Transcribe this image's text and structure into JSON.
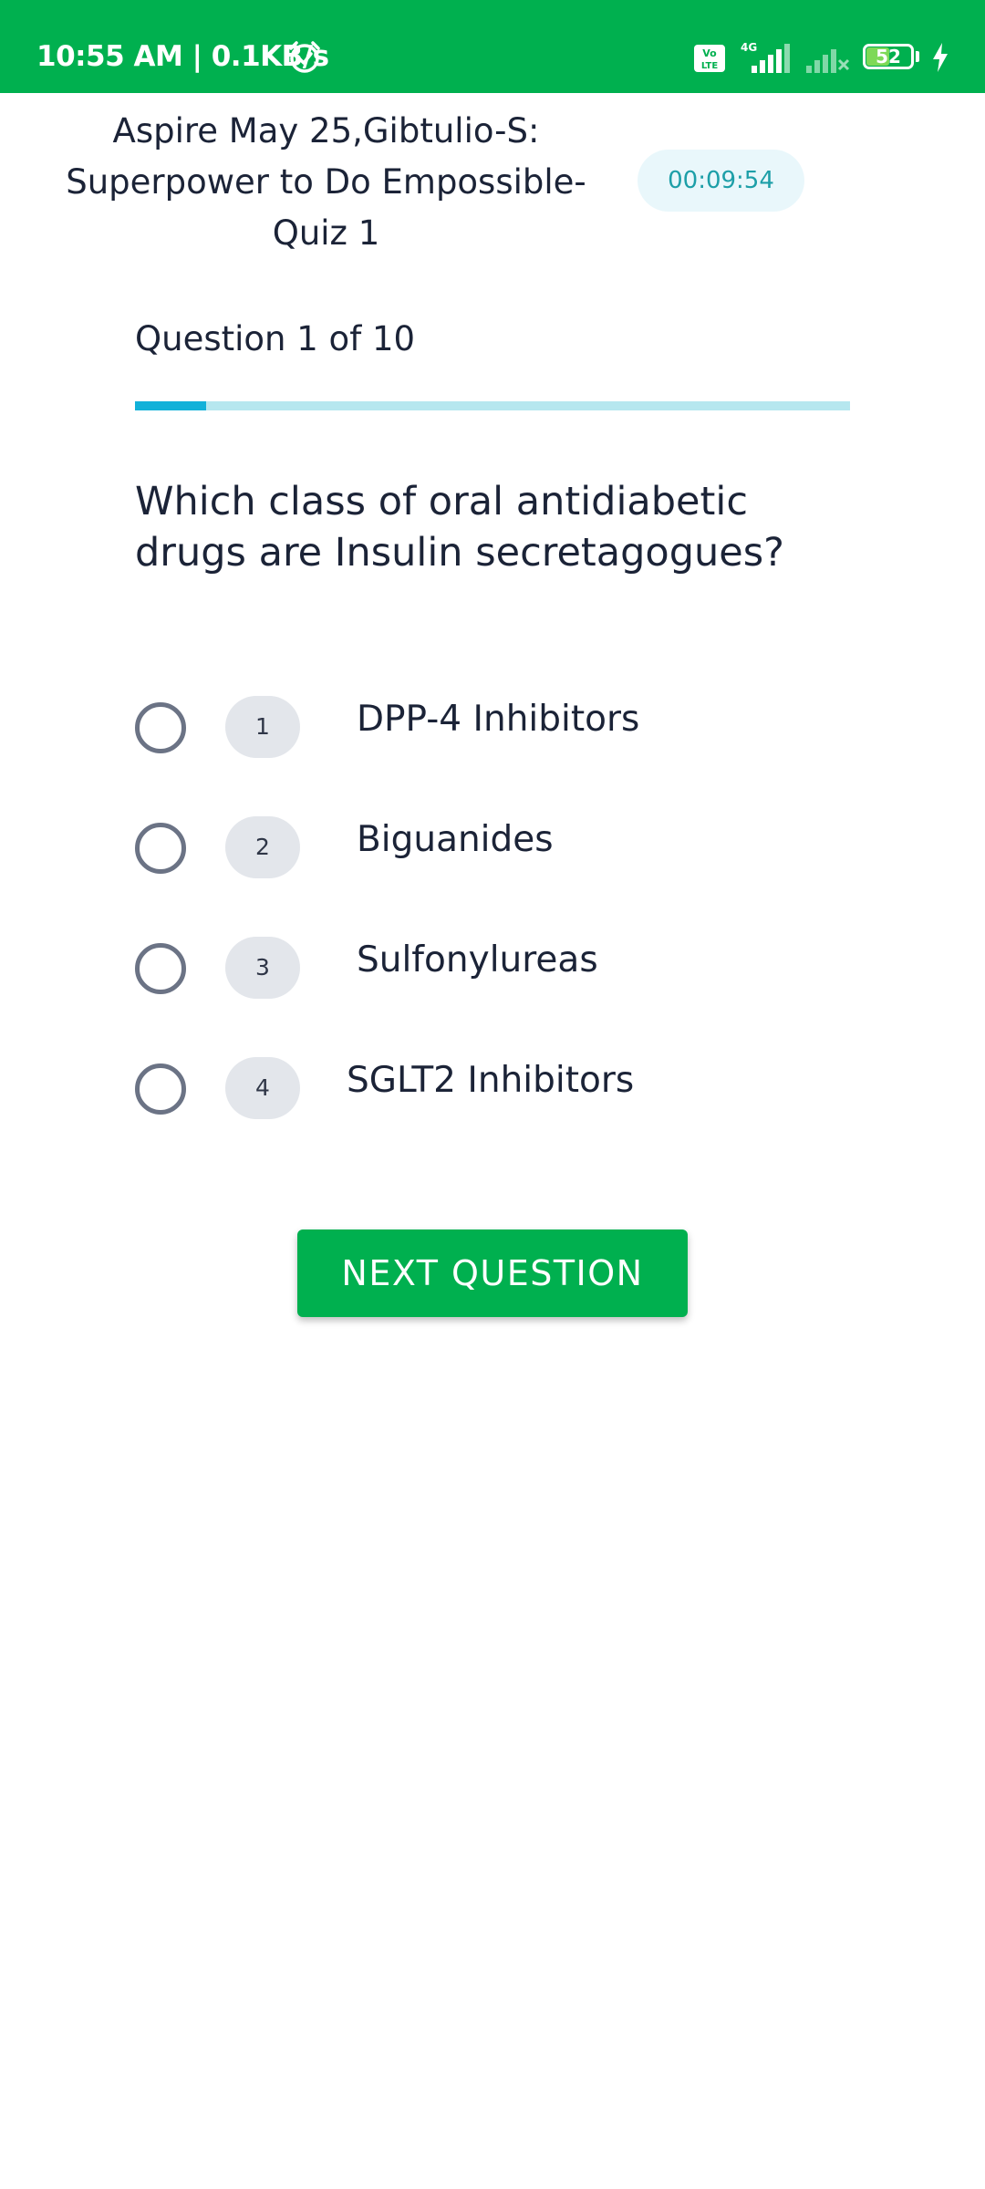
{
  "status_bar": {
    "time": "10:55 AM | 0.1KB/s",
    "battery": "52",
    "battery_level": 0.52,
    "icons": [
      "alarm-icon",
      "volte-icon",
      "signal-icon",
      "signal-icon",
      "battery-icon",
      "charging-icon"
    ]
  },
  "header": {
    "title": "Aspire May 25,Gibtulio-S: Superpower to Do Empossible- Quiz 1",
    "timer": "00:09:54"
  },
  "progress": {
    "label": "Question 1 of 10",
    "current": 1,
    "total": 10
  },
  "question": {
    "text": "Which class of oral antidiabetic drugs are Insulin secretagogues?"
  },
  "options": [
    {
      "number": "1",
      "label": "DPP-4 Inhibitors",
      "selected": false
    },
    {
      "number": "2",
      "label": "Biguanides",
      "selected": false
    },
    {
      "number": "3",
      "label": "Sulfonylureas",
      "selected": false
    },
    {
      "number": "4",
      "label": "SGLT2 Inhibitors",
      "selected": false
    }
  ],
  "actions": {
    "next_label": "NEXT QUESTION"
  },
  "colors": {
    "brand_green": "#00b04f",
    "progress_fill": "#12b1d9",
    "progress_track": "#b6e7ef",
    "timer_text": "#1d9fa8",
    "timer_bg": "#e9f7fb"
  }
}
